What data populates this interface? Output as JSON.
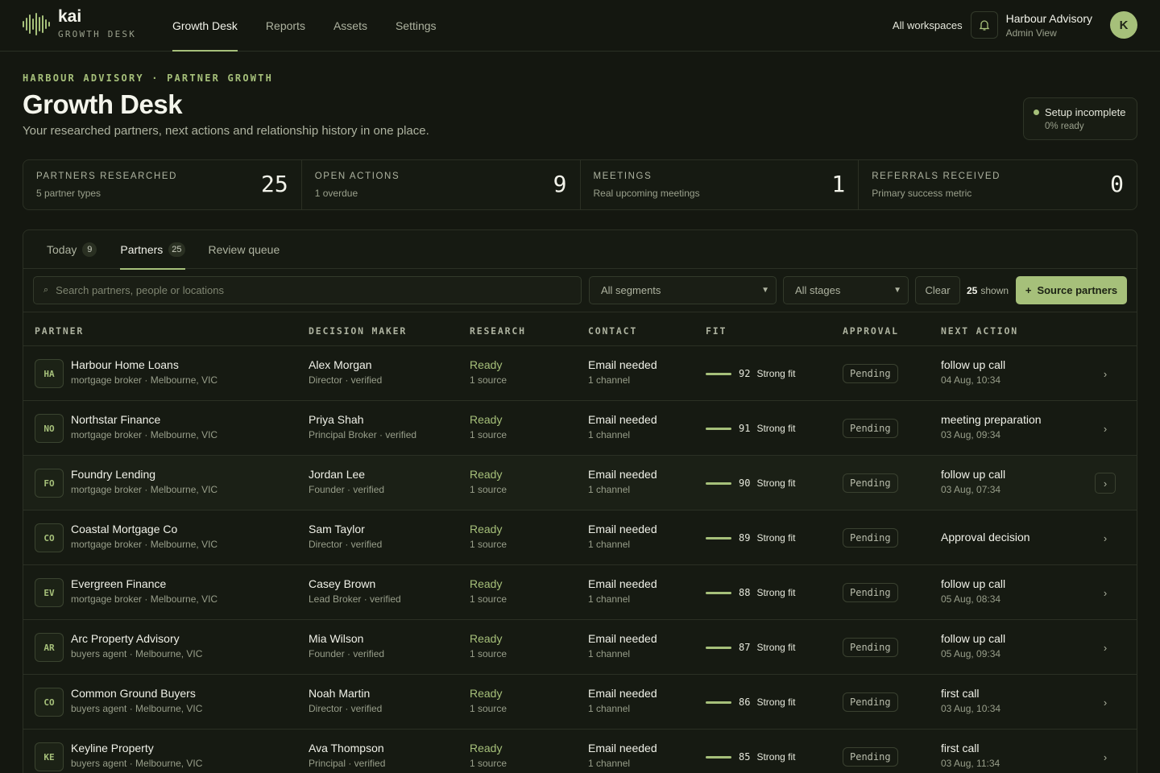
{
  "brand": {
    "name": "kai",
    "subtitle": "GROWTH DESK"
  },
  "nav": [
    {
      "label": "Growth Desk",
      "active": true
    },
    {
      "label": "Reports",
      "active": false
    },
    {
      "label": "Assets",
      "active": false
    },
    {
      "label": "Settings",
      "active": false
    }
  ],
  "topbar": {
    "workspaces_label": "All workspaces",
    "account_name": "Harbour Advisory",
    "account_role": "Admin View",
    "avatar_initial": "K"
  },
  "header": {
    "breadcrumb": "HARBOUR ADVISORY · PARTNER GROWTH",
    "title": "Growth Desk",
    "subtitle": "Your researched partners, next actions and relationship history in one place."
  },
  "setup": {
    "title": "Setup incomplete",
    "progress": "0% ready"
  },
  "stats": [
    {
      "label": "PARTNERS RESEARCHED",
      "sub": "5 partner types",
      "value": "25"
    },
    {
      "label": "OPEN ACTIONS",
      "sub": "1 overdue",
      "value": "9"
    },
    {
      "label": "MEETINGS",
      "sub": "Real upcoming meetings",
      "value": "1"
    },
    {
      "label": "REFERRALS RECEIVED",
      "sub": "Primary success metric",
      "value": "0"
    }
  ],
  "tabs": [
    {
      "label": "Today",
      "count": "9",
      "active": false
    },
    {
      "label": "Partners",
      "count": "25",
      "active": true
    },
    {
      "label": "Review queue",
      "count": "",
      "active": false
    }
  ],
  "filters": {
    "search_placeholder": "Search partners, people or locations",
    "segment": "All segments",
    "stage": "All stages",
    "clear": "Clear",
    "shown_count": "25",
    "shown_label": "shown",
    "source_button": "Source partners"
  },
  "table": {
    "headers": {
      "partner": "PARTNER",
      "decision_maker": "DECISION MAKER",
      "research": "RESEARCH",
      "contact": "CONTACT",
      "fit": "FIT",
      "approval": "APPROVAL",
      "next_action": "NEXT ACTION"
    },
    "rows": [
      {
        "initials": "HA",
        "name": "Harbour Home Loans",
        "meta": "mortgage broker · Melbourne, VIC",
        "dm_name": "Alex Morgan",
        "dm_role": "Director · verified",
        "research": "Ready",
        "research_sub": "1 source",
        "contact": "Email needed",
        "contact_sub": "1 channel",
        "fit": "92",
        "fit_label": "Strong fit",
        "approval": "Pending",
        "next": "follow up call",
        "next_time": "04 Aug, 10:34"
      },
      {
        "initials": "NO",
        "name": "Northstar Finance",
        "meta": "mortgage broker · Melbourne, VIC",
        "dm_name": "Priya Shah",
        "dm_role": "Principal Broker · verified",
        "research": "Ready",
        "research_sub": "1 source",
        "contact": "Email needed",
        "contact_sub": "1 channel",
        "fit": "91",
        "fit_label": "Strong fit",
        "approval": "Pending",
        "next": "meeting preparation",
        "next_time": "03 Aug, 09:34"
      },
      {
        "initials": "FO",
        "name": "Foundry Lending",
        "meta": "mortgage broker · Melbourne, VIC",
        "dm_name": "Jordan Lee",
        "dm_role": "Founder · verified",
        "research": "Ready",
        "research_sub": "1 source",
        "contact": "Email needed",
        "contact_sub": "1 channel",
        "fit": "90",
        "fit_label": "Strong fit",
        "approval": "Pending",
        "next": "follow up call",
        "next_time": "03 Aug, 07:34"
      },
      {
        "initials": "CO",
        "name": "Coastal Mortgage Co",
        "meta": "mortgage broker · Melbourne, VIC",
        "dm_name": "Sam Taylor",
        "dm_role": "Director · verified",
        "research": "Ready",
        "research_sub": "1 source",
        "contact": "Email needed",
        "contact_sub": "1 channel",
        "fit": "89",
        "fit_label": "Strong fit",
        "approval": "Pending",
        "next": "Approval decision",
        "next_time": ""
      },
      {
        "initials": "EV",
        "name": "Evergreen Finance",
        "meta": "mortgage broker · Melbourne, VIC",
        "dm_name": "Casey Brown",
        "dm_role": "Lead Broker · verified",
        "research": "Ready",
        "research_sub": "1 source",
        "contact": "Email needed",
        "contact_sub": "1 channel",
        "fit": "88",
        "fit_label": "Strong fit",
        "approval": "Pending",
        "next": "follow up call",
        "next_time": "05 Aug, 08:34"
      },
      {
        "initials": "AR",
        "name": "Arc Property Advisory",
        "meta": "buyers agent · Melbourne, VIC",
        "dm_name": "Mia Wilson",
        "dm_role": "Founder · verified",
        "research": "Ready",
        "research_sub": "1 source",
        "contact": "Email needed",
        "contact_sub": "1 channel",
        "fit": "87",
        "fit_label": "Strong fit",
        "approval": "Pending",
        "next": "follow up call",
        "next_time": "05 Aug, 09:34"
      },
      {
        "initials": "CO",
        "name": "Common Ground Buyers",
        "meta": "buyers agent · Melbourne, VIC",
        "dm_name": "Noah Martin",
        "dm_role": "Director · verified",
        "research": "Ready",
        "research_sub": "1 source",
        "contact": "Email needed",
        "contact_sub": "1 channel",
        "fit": "86",
        "fit_label": "Strong fit",
        "approval": "Pending",
        "next": "first call",
        "next_time": "03 Aug, 10:34"
      },
      {
        "initials": "KE",
        "name": "Keyline Property",
        "meta": "buyers agent · Melbourne, VIC",
        "dm_name": "Ava Thompson",
        "dm_role": "Principal · verified",
        "research": "Ready",
        "research_sub": "1 source",
        "contact": "Email needed",
        "contact_sub": "1 channel",
        "fit": "85",
        "fit_label": "Strong fit",
        "approval": "Pending",
        "next": "first call",
        "next_time": "03 Aug, 11:34"
      }
    ]
  },
  "colors": {
    "accent": "#a6c07a",
    "background": "#141710",
    "panel": "#161a12"
  }
}
